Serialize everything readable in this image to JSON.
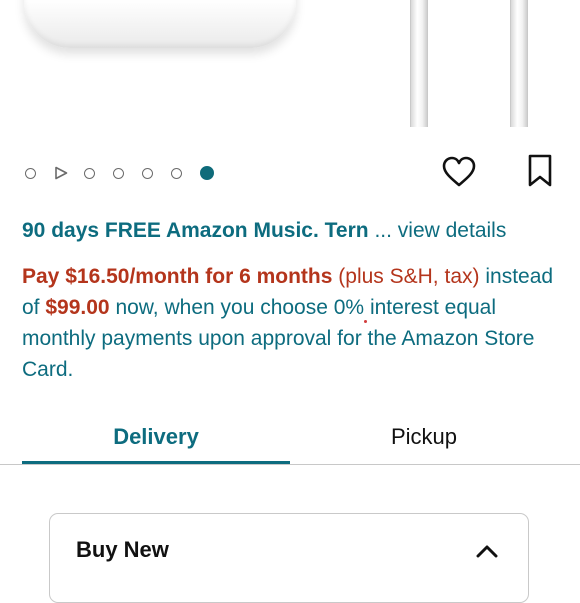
{
  "product": {
    "image_alt": "AirPods product image"
  },
  "carousel": {
    "items": [
      "image",
      "video",
      "image",
      "image",
      "image",
      "image",
      "image"
    ],
    "active_index": 6
  },
  "actions": {
    "favorite_icon": "heart-icon",
    "save_icon": "bookmark-icon"
  },
  "promo": {
    "bold_text": "90 days FREE Amazon Music. Tern",
    "link_text": "... view details"
  },
  "payment": {
    "pay_label": "Pay",
    "monthly_amount": "$16.50/month for 6 months",
    "suffix_1": "(plus S&H, tax)",
    "instead_of": "instead of",
    "full_price": "$99.00",
    "rest": "now, when you choose 0% interest equal monthly payments upon approval for the Amazon Store Card."
  },
  "tabs": [
    {
      "label": "Delivery",
      "selected": true
    },
    {
      "label": "Pickup",
      "selected": false
    }
  ],
  "buy_new": {
    "title": "Buy New",
    "expanded": true
  },
  "colors": {
    "accent": "#0d6c7f",
    "price": "#b4351c"
  }
}
